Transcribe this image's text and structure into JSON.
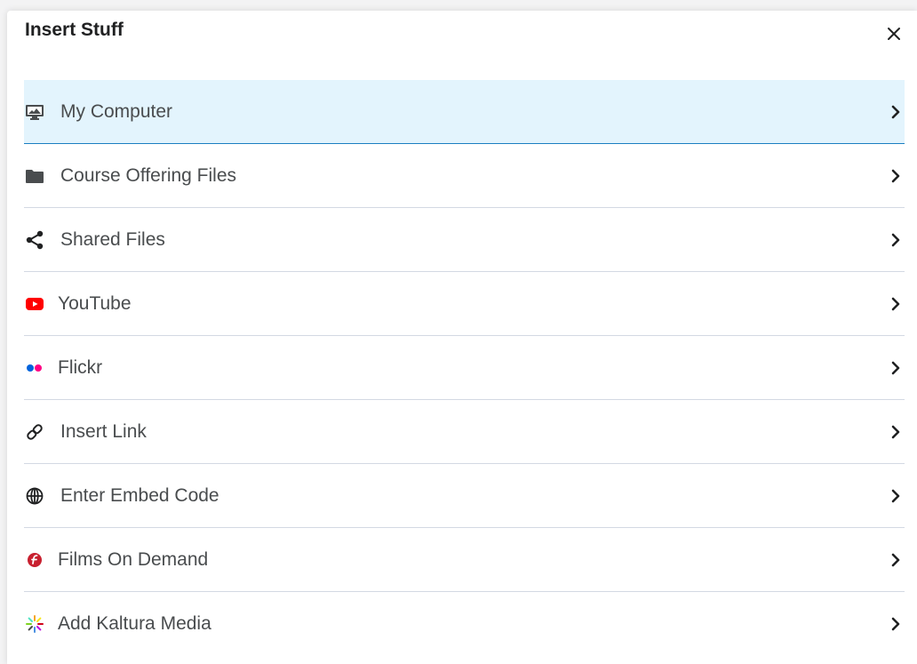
{
  "dialog": {
    "title": "Insert Stuff",
    "close_icon": "close-icon"
  },
  "items": [
    {
      "label": "My Computer",
      "icon": "monitor-icon",
      "selected": true
    },
    {
      "label": "Course Offering Files",
      "icon": "folder-icon"
    },
    {
      "label": "Shared Files",
      "icon": "share-icon"
    },
    {
      "label": "YouTube",
      "icon": "youtube-icon",
      "color": "#ff0000"
    },
    {
      "label": "Flickr",
      "icon": "flickr-icon",
      "colors": [
        "#0063dc",
        "#ff0084"
      ]
    },
    {
      "label": "Insert Link",
      "icon": "link-icon"
    },
    {
      "label": "Enter Embed Code",
      "icon": "globe-icon"
    },
    {
      "label": "Films On Demand",
      "icon": "films-on-demand-icon",
      "color": "#c8202f"
    },
    {
      "label": "Add Kaltura Media",
      "icon": "kaltura-icon"
    }
  ],
  "colors": {
    "selected_bg": "#e3f4fd",
    "selected_border": "#1a7fc1",
    "divider": "#d3d9e3",
    "text": "#494c4e"
  }
}
